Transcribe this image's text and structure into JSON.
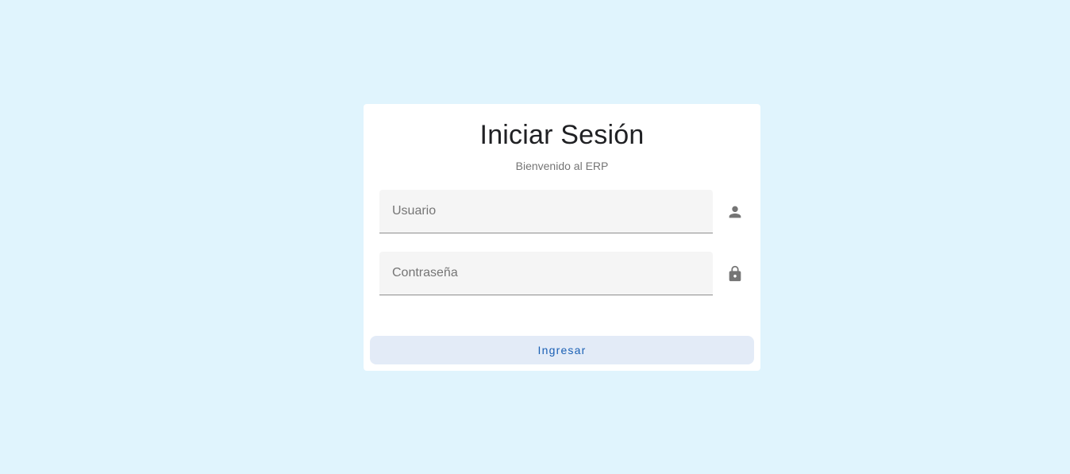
{
  "login": {
    "title": "Iniciar Sesión",
    "subtitle": "Bienvenido al ERP",
    "username": {
      "placeholder": "Usuario",
      "value": "",
      "icon": "person-icon"
    },
    "password": {
      "placeholder": "Contraseña",
      "value": "",
      "icon": "lock-icon"
    },
    "submit_label": "Ingresar"
  },
  "colors": {
    "page_background": "#e0f4fd",
    "card_background": "#ffffff",
    "field_background": "#f5f5f5",
    "button_background": "#e3ebf7",
    "button_text": "#1a5fb4",
    "icon": "#757575"
  }
}
